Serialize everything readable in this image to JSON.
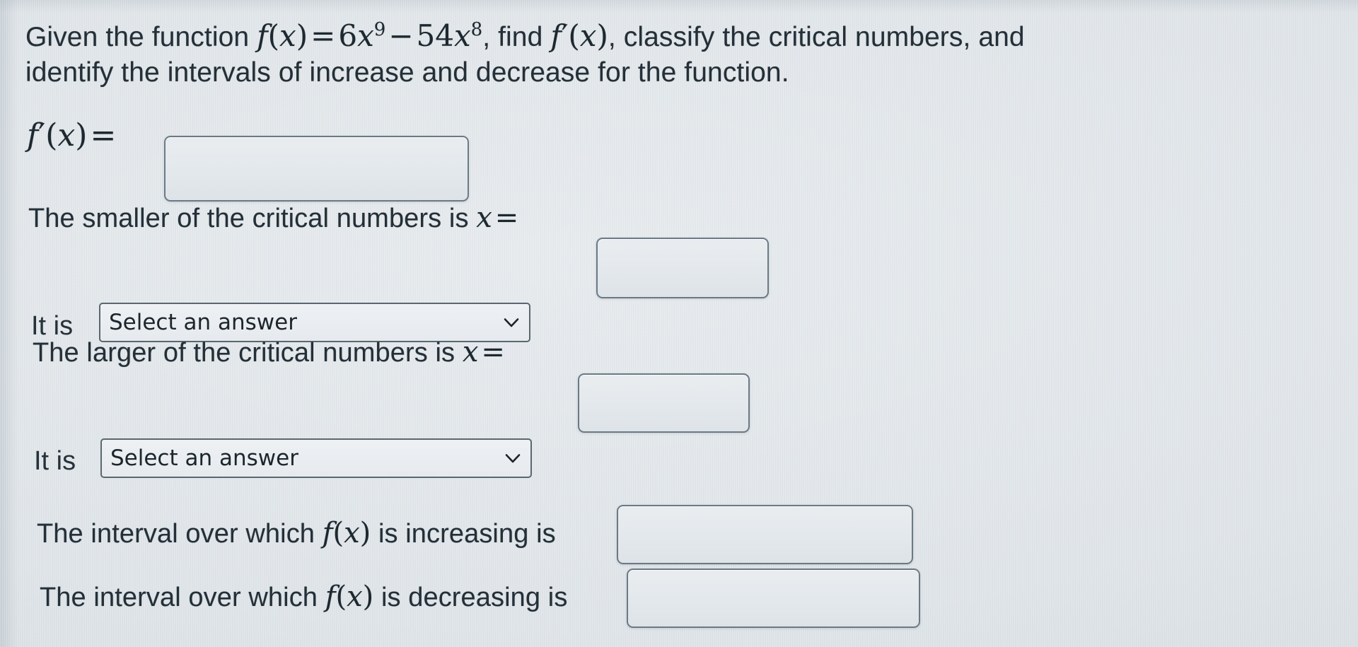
{
  "problem": {
    "prompt_part1": "Given the function ",
    "function_expr": "f(x) = 6x⁹ − 54x⁸",
    "prompt_part2": ", find ",
    "derivative_expr": "f′(x)",
    "prompt_part3": ", classify the critical numbers, and identify the intervals of increase and decrease for the function.",
    "full_prompt": "Given the function f(x) = 6x^9 - 54x^8, find f'(x), classify the critical numbers, and identify the intervals of increase and decrease for the function."
  },
  "math": {
    "f_of_x": "f",
    "var_x": "x",
    "coef_1": "6",
    "exp_1": "9",
    "minus": "−",
    "coef_2": "54",
    "exp_2": "8",
    "equals": "=",
    "prime": "′"
  },
  "fields": {
    "derivative": {
      "label": "f′(x) =",
      "value": "",
      "placeholder": ""
    },
    "smaller_critical": {
      "label": "The smaller of the critical numbers is ",
      "label_var": "x",
      "label_eq": "=",
      "value": "",
      "placeholder": ""
    },
    "smaller_classify": {
      "label": "It is",
      "selected": "Select an answer",
      "options": [
        "Select an answer"
      ]
    },
    "larger_critical": {
      "label": "The larger of the critical numbers is ",
      "label_var": "x",
      "label_eq": "=",
      "value": "",
      "placeholder": ""
    },
    "larger_classify": {
      "label": "It is",
      "selected": "Select an answer",
      "options": [
        "Select an answer"
      ]
    },
    "increasing": {
      "label_a": "The interval over which ",
      "label_fx": "f(x)",
      "label_b": " is increasing is",
      "value": "",
      "placeholder": ""
    },
    "decreasing": {
      "label_a": "The interval over which ",
      "label_fx": "f(x)",
      "label_b": " is decreasing is",
      "value": "",
      "placeholder": ""
    }
  },
  "icons": {
    "chevron_down": "chevron-down-icon"
  },
  "colors": {
    "background": "#dfe4e8",
    "text": "#243038",
    "field_border": "#6b7a85",
    "select_border": "#59686f",
    "field_fill": "#e6ebef"
  }
}
